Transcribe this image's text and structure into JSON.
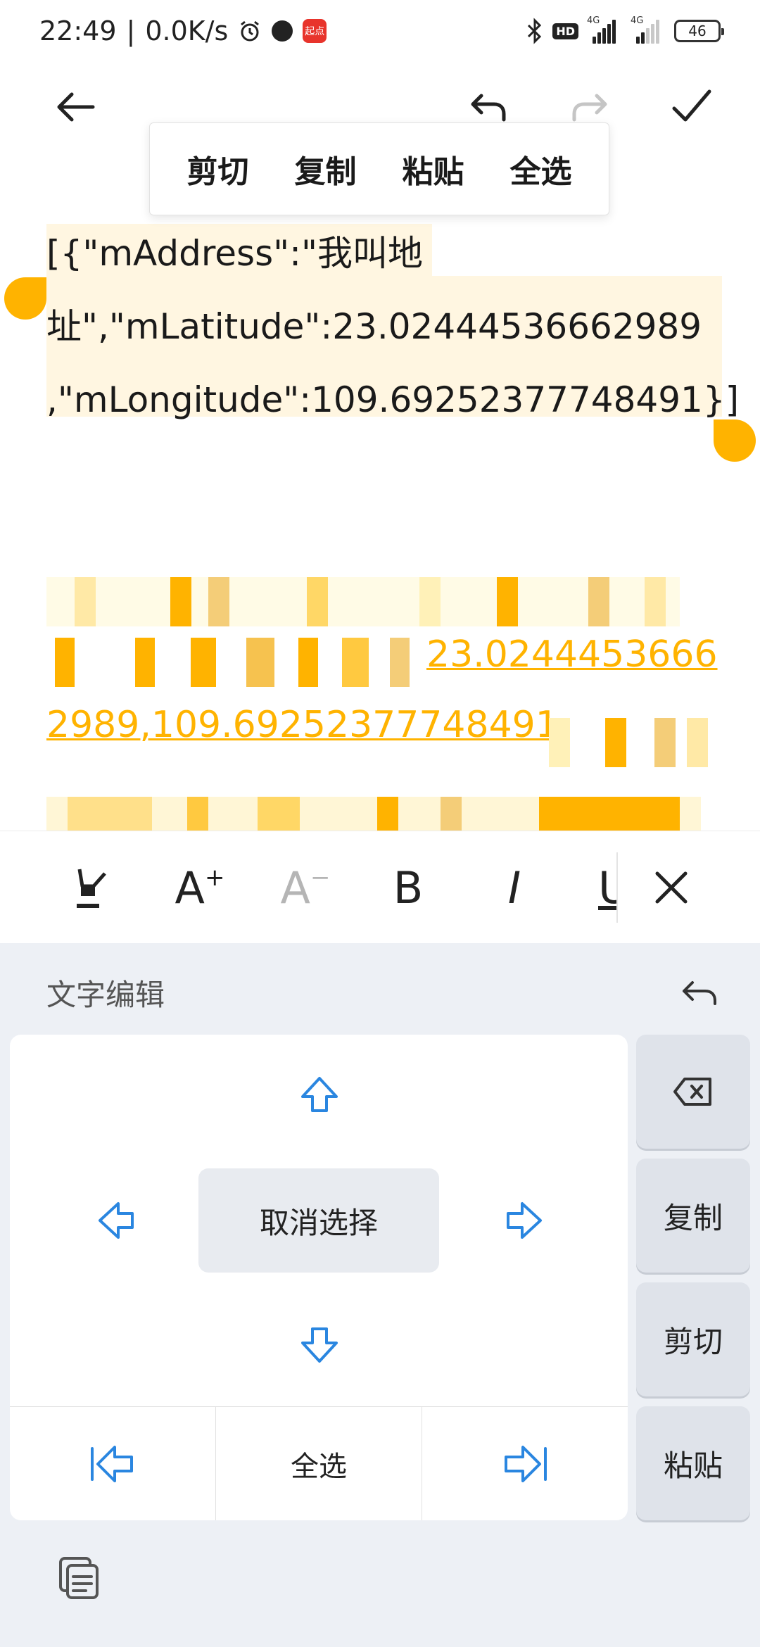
{
  "status_bar": {
    "time": "22:49",
    "separator": "|",
    "net_speed": "0.0K/s",
    "app_badge": "起点",
    "net_type_1": "4G",
    "net_type_2": "4G",
    "hd_label": "HD",
    "battery": "46",
    "icons": [
      "alarm-icon",
      "clock-icon",
      "bluetooth-icon",
      "signal-icon",
      "battery-icon"
    ]
  },
  "context_menu": {
    "cut": "剪切",
    "copy": "复制",
    "paste": "粘贴",
    "select_all": "全选"
  },
  "editor": {
    "line1": "[{\"mAddress\":\"我叫地",
    "line2": "址\",\"mLatitude\":23.02444536662989",
    "line3": ",\"mLongitude\":109.69252377748491}]",
    "link_part1": "23.0244453666",
    "link_part2": "2989,109.69252377748491"
  },
  "format_bar": {
    "increase_font": "A",
    "increase_sup": "+",
    "decrease_font": "A",
    "decrease_sup": "−",
    "bold": "B",
    "italic": "I",
    "underline": "U"
  },
  "keyboard_panel": {
    "title": "文字编辑",
    "cancel_select": "取消选择",
    "select_all": "全选",
    "delete": "",
    "copy": "复制",
    "cut": "剪切",
    "paste": "粘贴"
  },
  "colors": {
    "selection_handle": "#ffb300",
    "selection_bg": "#fff6e1",
    "link": "#ffb300",
    "arrow_blue": "#2a86e0"
  }
}
